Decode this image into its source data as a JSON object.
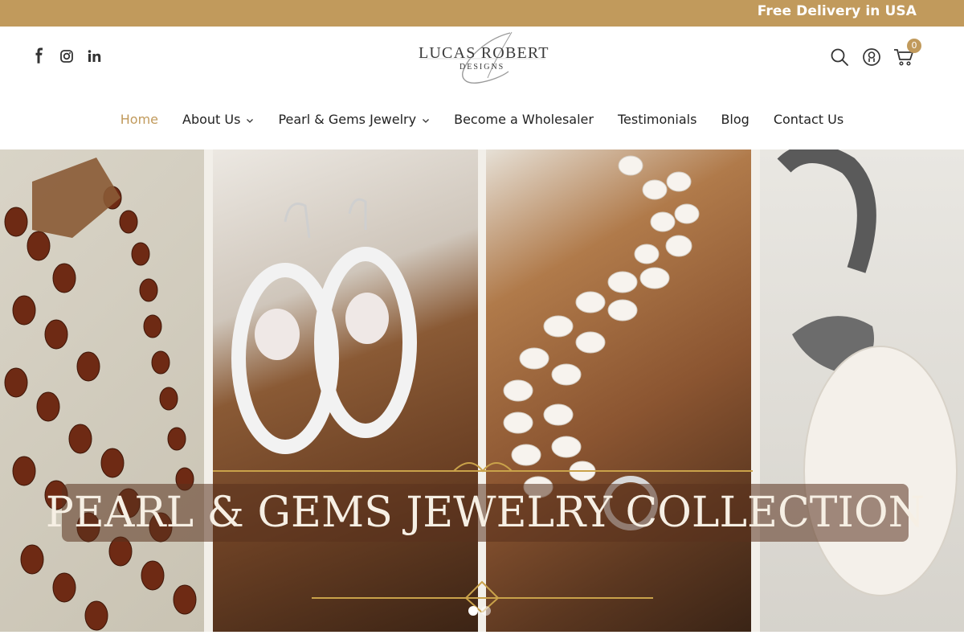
{
  "topbar": {
    "promo": "Free Delivery in USA"
  },
  "social": [
    {
      "icon": "facebook-icon"
    },
    {
      "icon": "instagram-icon"
    },
    {
      "icon": "linkedin-icon"
    }
  ],
  "logo": {
    "brand": "LUCAS ROBERT",
    "sub": "DESIGNS"
  },
  "header_icons": {
    "search": "search-icon",
    "account": "user-icon",
    "cart": "cart-icon",
    "cart_count": "0"
  },
  "nav": {
    "items": [
      {
        "label": "Home",
        "active": true,
        "dropdown": false
      },
      {
        "label": "About Us",
        "active": false,
        "dropdown": true
      },
      {
        "label": "Pearl & Gems Jewelry",
        "active": false,
        "dropdown": true
      },
      {
        "label": "Become a Wholesaler",
        "active": false,
        "dropdown": false
      },
      {
        "label": "Testimonials",
        "active": false,
        "dropdown": false
      },
      {
        "label": "Blog",
        "active": false,
        "dropdown": false
      },
      {
        "label": "Contact Us",
        "active": false,
        "dropdown": false
      }
    ]
  },
  "hero": {
    "title": "PEARL & GEMS JEWELRY COLLECTION",
    "slides": 2,
    "active_slide": 1
  },
  "colors": {
    "accent": "#c19a5c",
    "text": "#222222",
    "banner_overlay": "#5a321e"
  }
}
